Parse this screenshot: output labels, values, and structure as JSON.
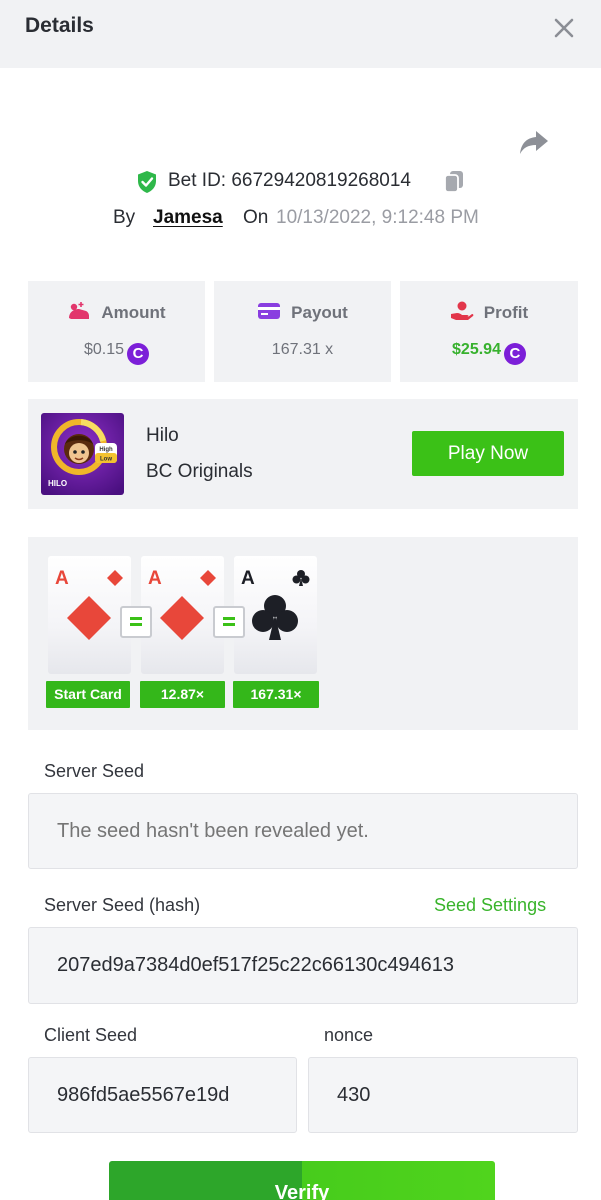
{
  "header": {
    "title": "Details"
  },
  "bet": {
    "id_text": "Bet ID: 66729420819268014",
    "by_label": "By",
    "user": "Jamesa",
    "on_label": "On",
    "date": "10/13/2022, 9:12:48 PM"
  },
  "stats": {
    "amount": {
      "label": "Amount",
      "value": "$0.15"
    },
    "payout": {
      "label": "Payout",
      "value": "167.31 x"
    },
    "profit": {
      "label": "Profit",
      "value": "$25.94"
    },
    "coin_symbol": "C"
  },
  "game": {
    "name": "Hilo",
    "provider": "BC Originals",
    "play_label": "Play Now",
    "thumb_text": {
      "title": "HILO",
      "high": "High",
      "low": "Low"
    }
  },
  "cards": [
    {
      "rank": "A",
      "suit": "diamond",
      "label": "Start Card"
    },
    {
      "rank": "A",
      "suit": "diamond",
      "label": "12.87×"
    },
    {
      "rank": "A",
      "suit": "club",
      "label": "167.31×"
    }
  ],
  "colors": {
    "accent_green": "#3bc117",
    "profit_green": "#37b12d",
    "coin_purple": "#7c1fd8",
    "diamond_red": "#e8473a"
  },
  "fairness": {
    "server_seed_label": "Server Seed",
    "server_seed_placeholder": "The seed hasn't been revealed yet.",
    "server_hash_label": "Server Seed (hash)",
    "seed_settings_label": "Seed Settings",
    "server_hash_value": "207ed9a7384d0ef517f25c22c66130c494613",
    "client_seed_label": "Client Seed",
    "client_seed_value": "986fd5ae5567e19d",
    "nonce_label": "nonce",
    "nonce_value": "430",
    "verify_label": "Verify"
  }
}
